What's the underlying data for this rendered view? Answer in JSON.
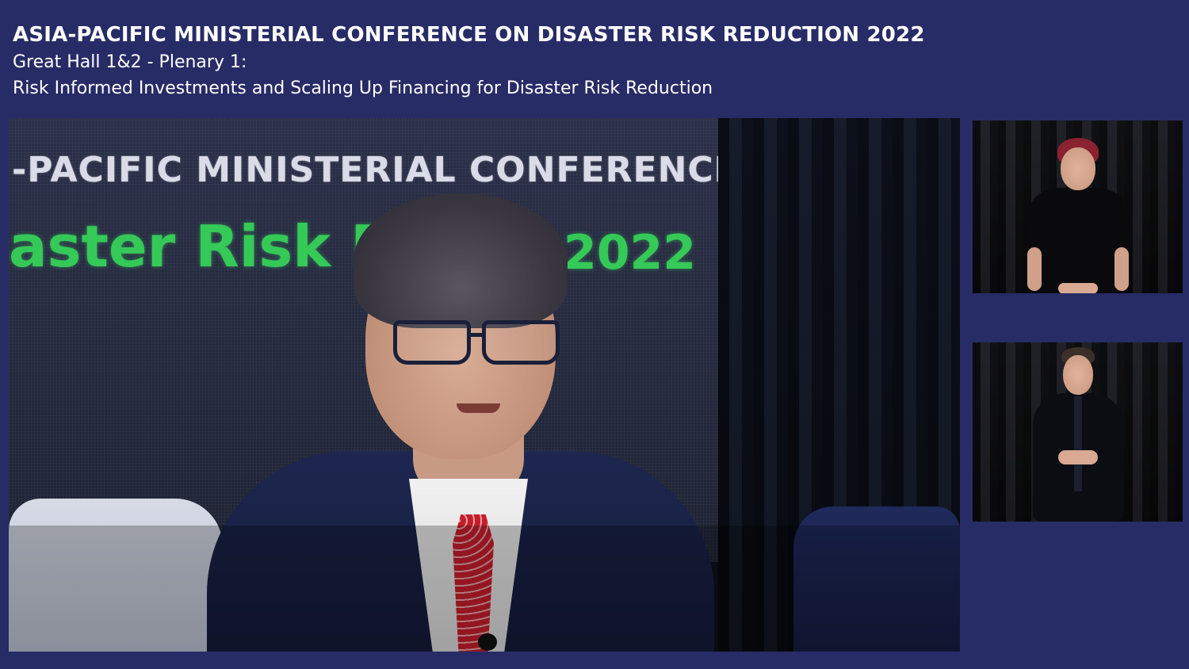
{
  "header": {
    "title": "ASIA-PACIFIC MINISTERIAL CONFERENCE ON DISASTER RISK REDUCTION 2022",
    "session_line": "Great Hall 1&2 - Plenary 1:",
    "session_title": "Risk Informed Investments and Scaling Up Financing for Disaster Risk Reduction"
  },
  "stage_video": {
    "screen_text_line1": "-PACIFIC MINISTERIAL CONFERENCE ON",
    "screen_text_line2": "aster Risk Re",
    "screen_text_year": "2022"
  },
  "colors": {
    "background": "#272c67",
    "screen_green": "#35c957",
    "title_text": "#ffffff"
  }
}
